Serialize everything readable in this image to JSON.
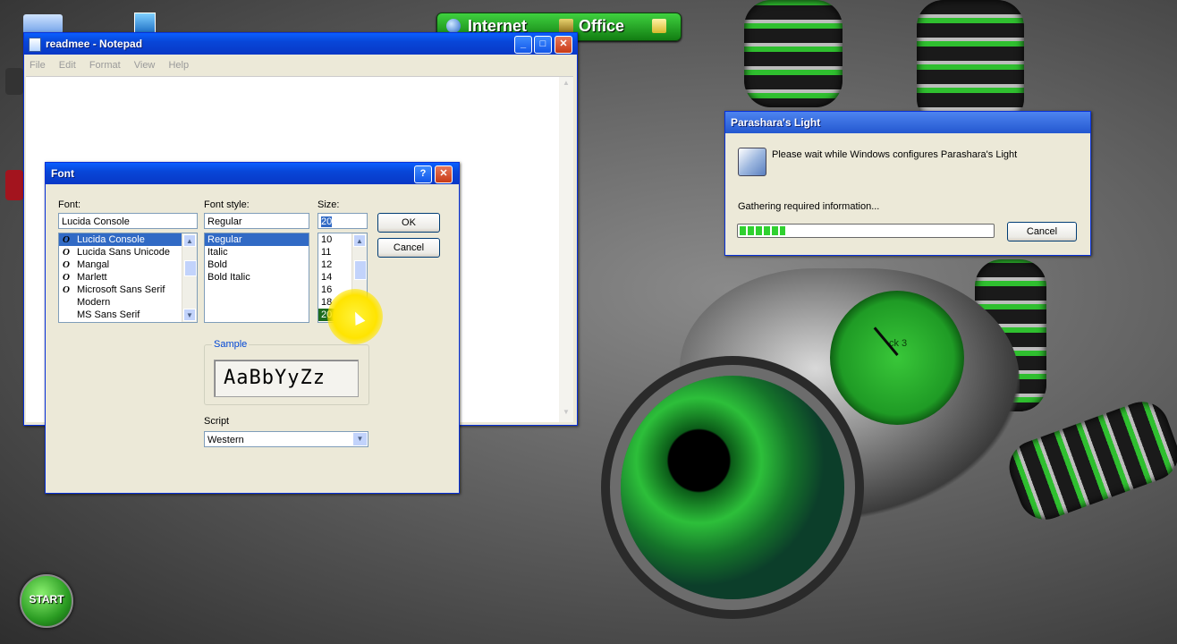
{
  "desktop": {
    "toolbar": {
      "internet_label": "Internet",
      "office_label": "Office"
    },
    "start_label": "START",
    "clock_label": "ck 3"
  },
  "notepad": {
    "title": "readmee - Notepad",
    "menu": [
      "File",
      "Edit",
      "Format",
      "View",
      "Help"
    ]
  },
  "font_dialog": {
    "title": "Font",
    "font_label": "Font:",
    "font_value": "Lucida Console",
    "fonts": [
      "Lucida Console",
      "Lucida Sans Unicode",
      "Mangal",
      "Marlett",
      "Microsoft Sans Serif",
      "Modern",
      "MS Sans Serif"
    ],
    "style_label": "Font style:",
    "style_value": "Regular",
    "styles": [
      "Regular",
      "Italic",
      "Bold",
      "Bold Italic"
    ],
    "size_label": "Size:",
    "size_value": "20",
    "sizes": [
      "10",
      "11",
      "12",
      "14",
      "16",
      "18",
      "20"
    ],
    "ok_label": "OK",
    "cancel_label": "Cancel",
    "sample_label": "Sample",
    "sample_text": "AaBbYyZz",
    "script_label": "Script",
    "script_value": "Western"
  },
  "installer": {
    "title": "Parashara's Light",
    "message": "Please wait while Windows configures Parashara's Light",
    "status": "Gathering required information...",
    "progress_fraction": 0.18,
    "cancel_label": "Cancel"
  },
  "colors": {
    "xp_blue": "#0a5fff",
    "selection": "#316ac5",
    "progress_green": "#2fd12f"
  }
}
